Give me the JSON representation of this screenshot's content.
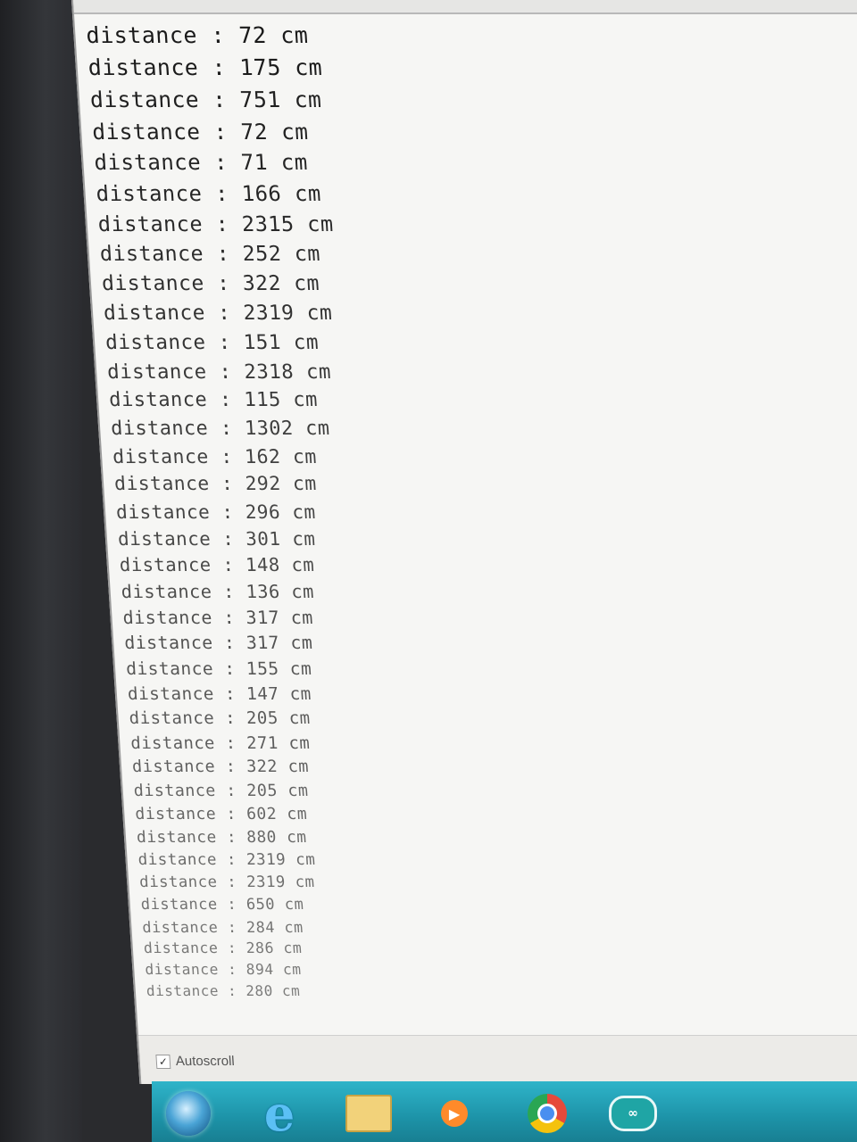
{
  "serial_monitor": {
    "lines": [
      "distance : 72 cm",
      "distance : 175 cm",
      "distance : 751 cm",
      "distance : 72 cm",
      "distance : 71 cm",
      "distance : 166 cm",
      "distance : 2315 cm",
      "distance : 252 cm",
      "distance : 322 cm",
      "distance : 2319 cm",
      "distance : 151 cm",
      "distance : 2318 cm",
      "distance : 115 cm",
      "distance : 1302 cm",
      "distance : 162 cm",
      "distance : 292 cm",
      "distance : 296 cm",
      "distance : 301 cm",
      "distance : 148 cm",
      "distance : 136 cm",
      "distance : 317 cm",
      "distance : 317 cm",
      "distance : 155 cm",
      "distance : 147 cm",
      "distance : 205 cm",
      "distance : 271 cm",
      "distance : 322 cm",
      "distance : 205 cm",
      "distance : 602 cm",
      "distance : 880 cm",
      "distance : 2319 cm",
      "distance : 2319 cm",
      "distance : 650 cm",
      "distance : 284 cm",
      "distance : 286 cm",
      "distance : 894 cm",
      "distance : 280 cm"
    ]
  },
  "footer": {
    "autoscroll_label": "Autoscroll",
    "autoscroll_checked": true,
    "checkmark": "✓"
  },
  "taskbar": {
    "icons": [
      "start-orb-icon",
      "internet-explorer-icon",
      "file-explorer-icon",
      "media-player-icon",
      "chrome-icon",
      "arduino-icon"
    ],
    "ie_glyph": "e",
    "arduino_glyph": "∞",
    "media_glyph": "▶"
  }
}
